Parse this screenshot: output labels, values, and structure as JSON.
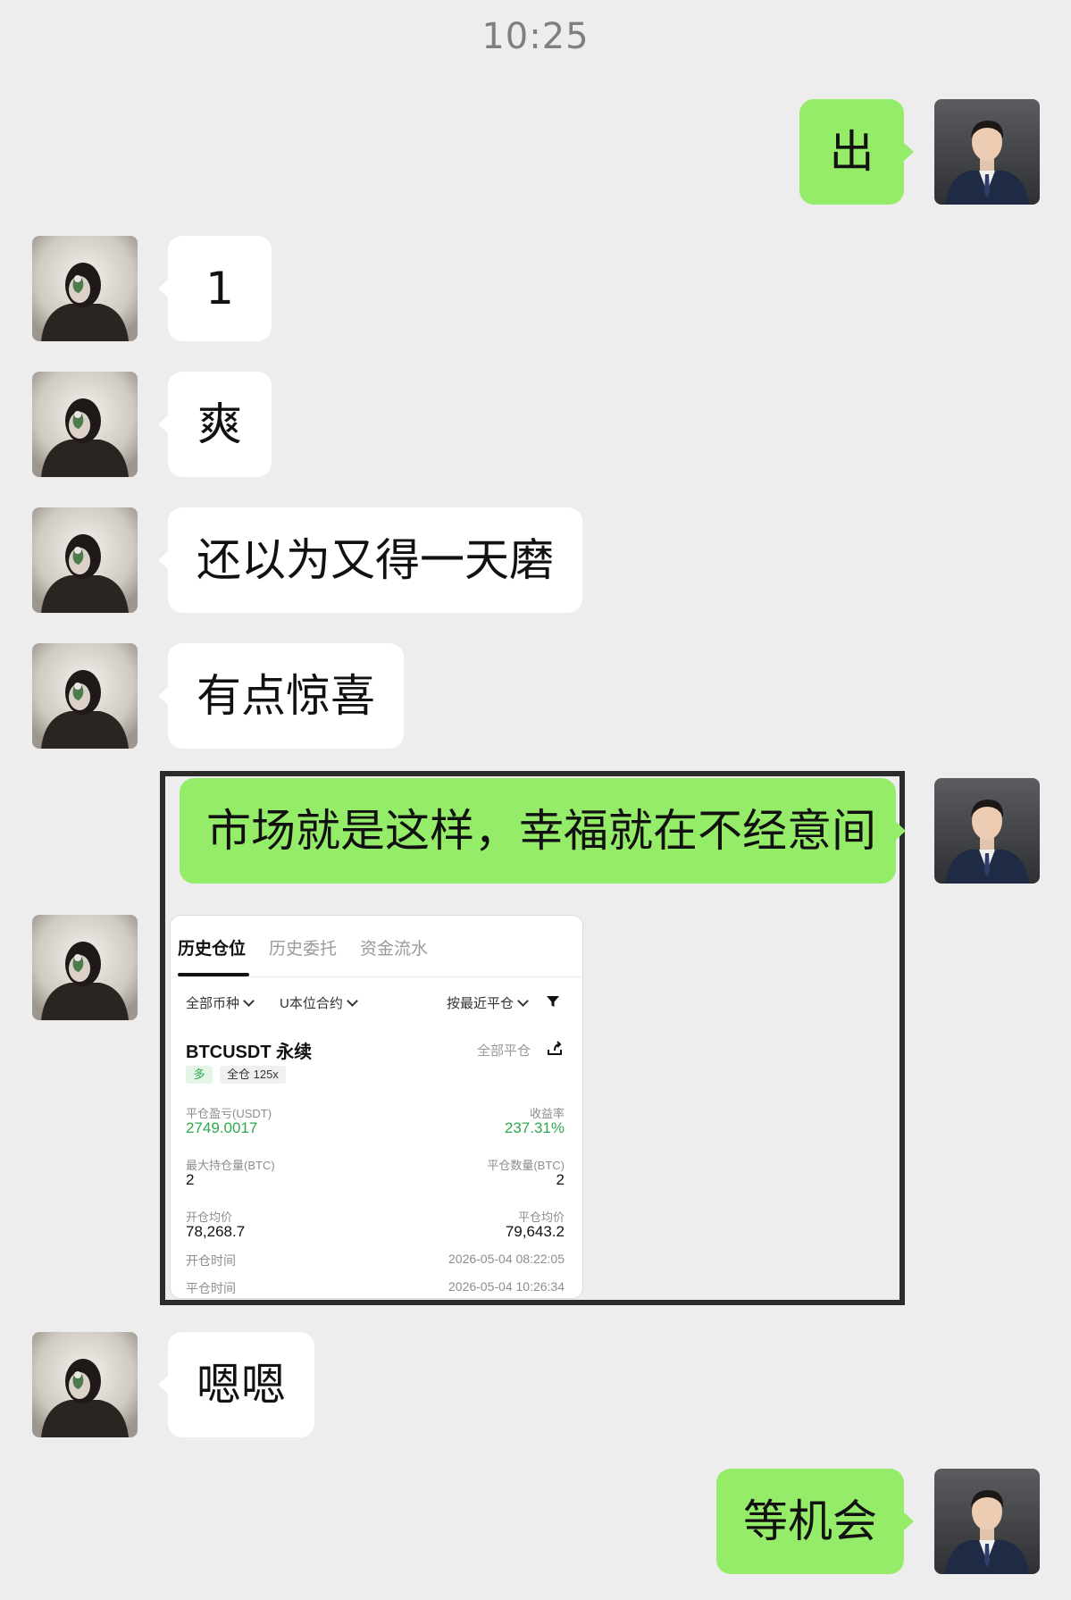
{
  "status": {
    "time": "10:25"
  },
  "colors": {
    "self_bubble": "#95ec69",
    "other_bubble": "#ffffff",
    "background": "#ededed",
    "profit_green": "#2fa84f"
  },
  "messages": [
    {
      "sender": "self",
      "text": "出"
    },
    {
      "sender": "other",
      "text": "1"
    },
    {
      "sender": "other",
      "text": "爽"
    },
    {
      "sender": "other",
      "text": "还以为又得一天磨"
    },
    {
      "sender": "other",
      "text": "有点惊喜"
    },
    {
      "sender": "self",
      "text": "市场就是这样，幸福就在不经意间"
    },
    {
      "sender": "other",
      "text": "[image]"
    },
    {
      "sender": "other",
      "text": "嗯嗯"
    },
    {
      "sender": "self",
      "text": "等机会"
    }
  ],
  "trade_card": {
    "tabs": [
      "历史仓位",
      "历史委托",
      "资金流水"
    ],
    "filters": {
      "coin": "全部币种",
      "contract": "U本位合约",
      "sort": "按最近平仓"
    },
    "symbol": "BTCUSDT 永续",
    "close_type": "全部平仓",
    "side": "多",
    "margin": "全仓 125x",
    "pnl_label": "平仓盈亏(USDT)",
    "pnl_value": "2749.0017",
    "roi_label": "收益率",
    "roi_value": "237.31%",
    "max_pos_label": "最大持仓量(BTC)",
    "max_pos_value": "2",
    "close_qty_label": "平仓数量(BTC)",
    "close_qty_value": "2",
    "open_avg_label": "开仓均价",
    "open_avg_value": "78,268.7",
    "close_avg_label": "平仓均价",
    "close_avg_value": "79,643.2",
    "open_time_label": "开仓时间",
    "open_time_value": "2026-05-04 08:22:05",
    "close_time_label": "平仓时间",
    "close_time_value": "2026-05-04 10:26:34"
  }
}
